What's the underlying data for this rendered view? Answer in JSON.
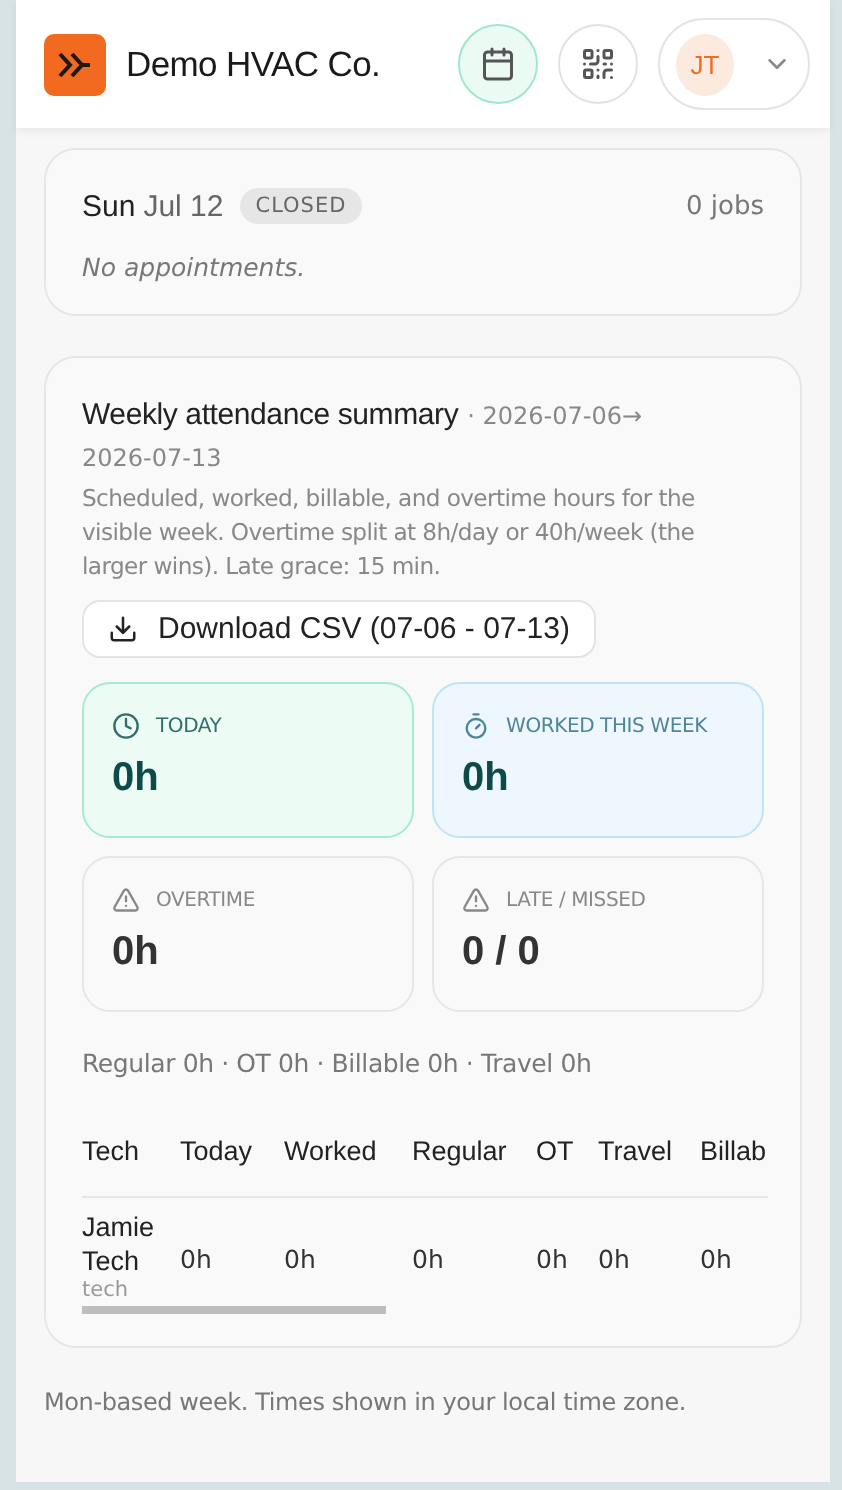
{
  "header": {
    "company": "Demo HVAC Co.",
    "avatar_initials": "JT"
  },
  "day": {
    "weekday": "Sun",
    "date": "Jul 12",
    "status": "CLOSED",
    "jobs": "0 jobs",
    "empty": "No appointments."
  },
  "summary": {
    "title": "Weekly attendance summary",
    "range_start": "· 2026-07-06→",
    "range_end": "2026-07-13",
    "description": "Scheduled, worked, billable, and overtime hours for the visible week. Overtime split at 8h/day or 40h/week (the larger wins). Late grace: 15 min.",
    "download": "Download CSV (07-06 - 07-13)",
    "stats": [
      {
        "kind": "today",
        "label": "TODAY",
        "value": "0h"
      },
      {
        "kind": "week",
        "label": "WORKED THIS WEEK",
        "value": "0h"
      },
      {
        "kind": "overtime",
        "label": "OVERTIME",
        "value": "0h"
      },
      {
        "kind": "late",
        "label": "LATE / MISSED",
        "value": "0 / 0"
      }
    ],
    "totals": "Regular 0h · OT 0h · Billable 0h · Travel 0h",
    "table": {
      "columns": [
        "Tech",
        "Today",
        "Worked",
        "Regular",
        "OT",
        "Travel",
        "Billab"
      ],
      "rows": [
        {
          "cells": [
            "Jamie Tech",
            "0h",
            "0h",
            "0h",
            "0h",
            "0h",
            "0h"
          ],
          "role": "tech"
        }
      ]
    }
  },
  "footer": "Mon-based week. Times shown in your local time zone."
}
